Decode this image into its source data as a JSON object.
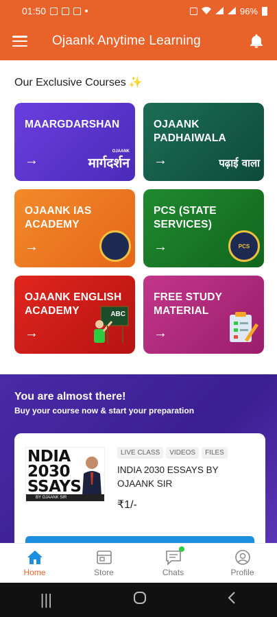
{
  "status_bar": {
    "time": "01:50",
    "battery": "96%"
  },
  "app_bar": {
    "title": "Ojaank Anytime Learning"
  },
  "section": {
    "title": "Our Exclusive Courses",
    "sparkle": "✨"
  },
  "courses": [
    {
      "title": "MAARGDARSHAN",
      "logo_text": "मार्गदर्शन",
      "logo_small": "OJAANK",
      "arrow": "→"
    },
    {
      "title": "OJAANK PADHAIWALA",
      "logo_text": "पढ़ाई वाला",
      "arrow": "→"
    },
    {
      "title": "OJAANK IAS ACADEMY",
      "arrow": "→"
    },
    {
      "title": "PCS (STATE SERVICES)",
      "logo_text": "PCS",
      "arrow": "→"
    },
    {
      "title": "OJAANK ENGLISH ACADEMY",
      "logo_text": "ABC",
      "arrow": "→"
    },
    {
      "title": "FREE STUDY MATERIAL",
      "arrow": "→"
    }
  ],
  "promo": {
    "title": "You are almost there!",
    "subtitle": "Buy your course now & start your preparation",
    "course": {
      "thumb_line1": "NDIA",
      "thumb_line2": "2030",
      "thumb_line3": "SSAYS",
      "thumb_strip": "BY OJAANK SIR",
      "tags": [
        "LIVE CLASS",
        "VIDEOS",
        "FILES"
      ],
      "name": "INDIA 2030 ESSAYS BY OJAANK SIR",
      "price": "₹1/-"
    }
  },
  "bottom_nav": [
    {
      "label": "Home",
      "icon": "home-icon",
      "active": true
    },
    {
      "label": "Store",
      "icon": "store-icon"
    },
    {
      "label": "Chats",
      "icon": "chat-icon"
    },
    {
      "label": "Profile",
      "icon": "profile-icon"
    }
  ],
  "colors": {
    "brand": "#e8622a",
    "promo_bg": "#3a1f90",
    "button_blue": "#1e8fe0"
  }
}
